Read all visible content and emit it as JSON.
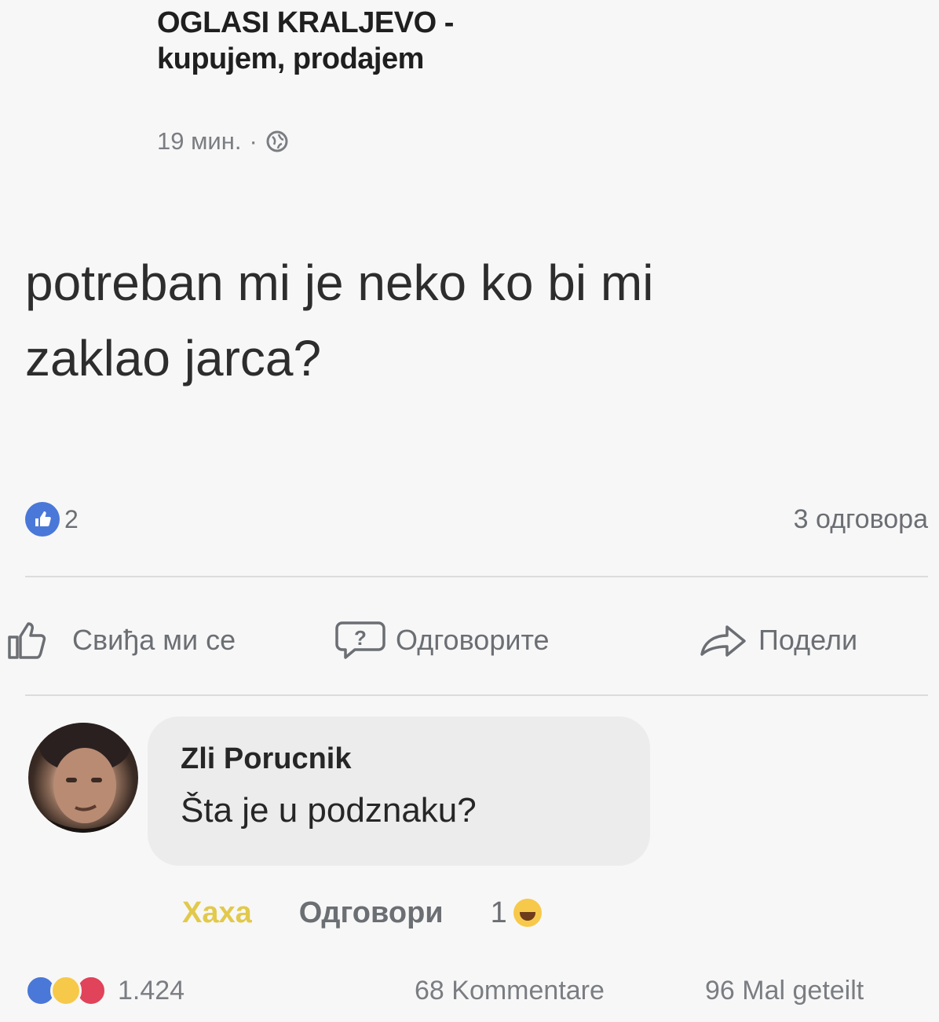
{
  "post": {
    "group_title_line1": "OGLASI KRALJEVO -",
    "group_title_line2": "kupujem, prodajem",
    "time": "19 мин.",
    "separator": "·",
    "privacy_icon": "globe-icon",
    "text_line1": "potreban mi je neko ko bi mi",
    "text_line2": "zaklao jarca?",
    "like_count": "2",
    "replies_count": "3 одговора"
  },
  "actions": {
    "like_label": "Свиђа ми се",
    "answer_label": "Одговорите",
    "share_label": "Подели"
  },
  "comment": {
    "author": "Zli Porucnik",
    "text": "Šta je u podznaku?",
    "haha_label": "Хаха",
    "reply_label": "Одговори",
    "reaction_count": "1"
  },
  "footer": {
    "reactions_total": "1.424",
    "comments": "68 Kommentare",
    "shares": "96 Mal geteilt"
  },
  "colors": {
    "like_blue": "#4a78d8",
    "haha_yellow": "#f7c94a",
    "love_red": "#e0435a",
    "muted_gray": "#6b6e73"
  }
}
